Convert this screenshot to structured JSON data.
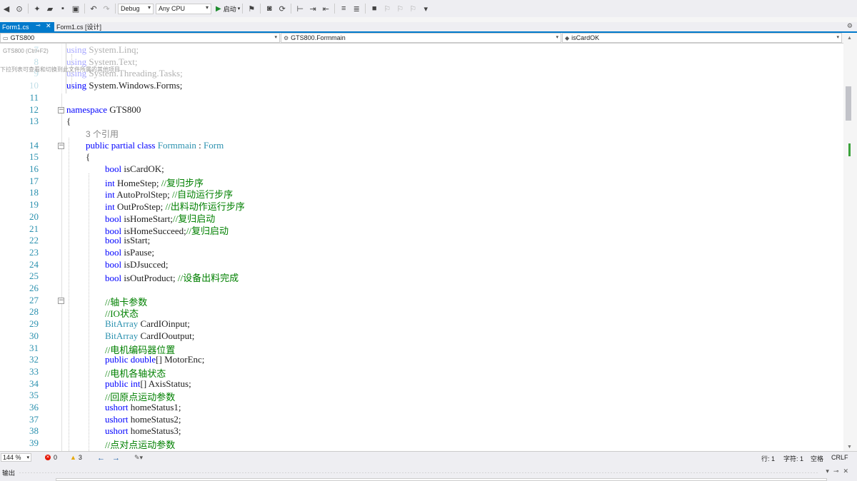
{
  "toolbar": {
    "config": "Debug",
    "platform": "Any CPU",
    "start_label": "启动"
  },
  "tabs": [
    {
      "label": "Form1.cs",
      "active": true
    },
    {
      "label": "Form1.cs [设计]",
      "active": false
    }
  ],
  "nav": {
    "project": "GTS800",
    "class": "GTS800.Formmain",
    "member": "isCardOK"
  },
  "overlay": {
    "shortcut": "GTS800 (Ctrl+F2)",
    "hint": "下拉列表可查看和切换到此文件所属的其他项目"
  },
  "code_lines": [
    {
      "n": "7",
      "t": "using System.Linq;"
    },
    {
      "n": "8",
      "t": "using System.Text;"
    },
    {
      "n": "9",
      "t": "using System.Threading.Tasks;"
    },
    {
      "n": "10",
      "t": "using System.Windows.Forms;"
    },
    {
      "n": "11",
      "t": ""
    },
    {
      "n": "12",
      "t": "namespace GTS800"
    },
    {
      "n": "13",
      "t": "{"
    },
    {
      "n": "",
      "t": "3 个引用"
    },
    {
      "n": "14",
      "t": "public partial class Formmain : Form"
    },
    {
      "n": "15",
      "t": "{"
    },
    {
      "n": "16",
      "t": "bool isCardOK;"
    },
    {
      "n": "17",
      "t": "int HomeStep; //复归步序"
    },
    {
      "n": "18",
      "t": "int AutoProlStep; //自动运行步序"
    },
    {
      "n": "19",
      "t": "int OutProStep; //出料动作运行步序"
    },
    {
      "n": "20",
      "t": "bool isHomeStart;//复归启动"
    },
    {
      "n": "21",
      "t": "bool isHomeSucceed;//复归启动"
    },
    {
      "n": "22",
      "t": "bool isStart;"
    },
    {
      "n": "23",
      "t": "bool isPause;"
    },
    {
      "n": "24",
      "t": "bool isDJsucced;"
    },
    {
      "n": "25",
      "t": "bool isOutProduct; //设备出料完成"
    },
    {
      "n": "26",
      "t": ""
    },
    {
      "n": "27",
      "t": "//轴卡参数"
    },
    {
      "n": "28",
      "t": "//IO状态"
    },
    {
      "n": "29",
      "t": "BitArray CardIOinput;"
    },
    {
      "n": "30",
      "t": "BitArray CardIOoutput;"
    },
    {
      "n": "31",
      "t": "//电机编码器位置"
    },
    {
      "n": "32",
      "t": "public double[] MotorEnc;"
    },
    {
      "n": "33",
      "t": "//电机各轴状态"
    },
    {
      "n": "34",
      "t": "public int[] AxisStatus;"
    },
    {
      "n": "35",
      "t": "//回原点运动参数"
    },
    {
      "n": "36",
      "t": "ushort homeStatus1;"
    },
    {
      "n": "37",
      "t": "ushort homeStatus2;"
    },
    {
      "n": "38",
      "t": "ushort homeStatus3;"
    },
    {
      "n": "39",
      "t": "//点对点运动参数"
    }
  ],
  "status": {
    "zoom": "144 %",
    "errors": "0",
    "warnings": "3",
    "line": "行: 1",
    "col": "字符: 1",
    "whitespace": "空格",
    "eol": "CRLF"
  },
  "output": {
    "title": "输出"
  },
  "icons": [
    "back-icon",
    "new-project-icon",
    "open-icon",
    "save-icon",
    "save-all-icon",
    "undo-icon",
    "redo-icon",
    "play-icon",
    "gear-icon",
    "close-icon",
    "pin-icon",
    "fold-icon",
    "error-icon",
    "warning-icon",
    "arrow-left-icon",
    "arrow-right-icon"
  ],
  "colors": {
    "accent": "#007acc",
    "keyword": "#0000ff",
    "type": "#2b91af",
    "comment": "#008000"
  }
}
